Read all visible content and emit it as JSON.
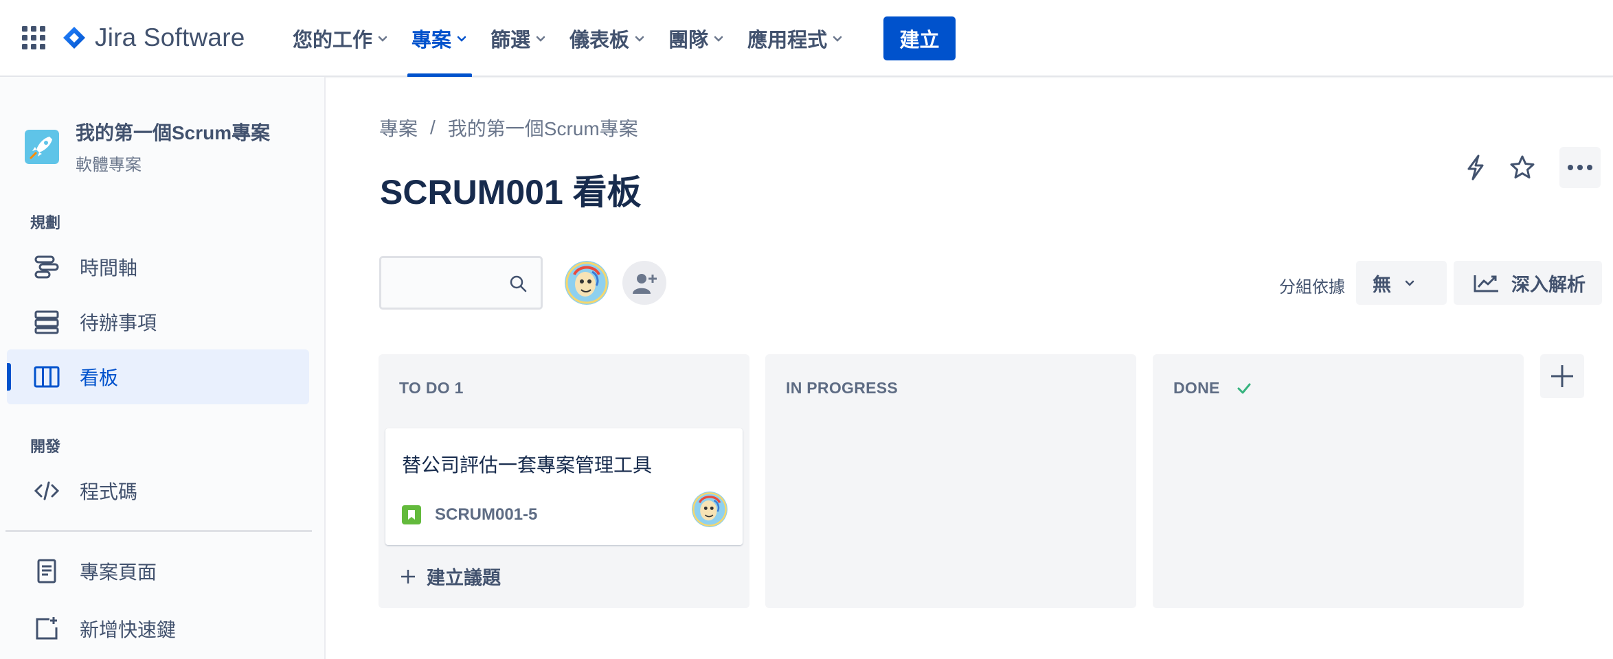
{
  "app": {
    "name": "Jira Software",
    "icons": {
      "apps": "app-switcher-grid-icon",
      "logo": "jira-diamond-logo"
    },
    "accent_color": "#0052cc"
  },
  "topnav": {
    "items": [
      {
        "label": "您的工作",
        "active": false
      },
      {
        "label": "專案",
        "active": true
      },
      {
        "label": "篩選",
        "active": false
      },
      {
        "label": "儀表板",
        "active": false
      },
      {
        "label": "團隊",
        "active": false
      },
      {
        "label": "應用程式",
        "active": false
      }
    ],
    "create_label": "建立"
  },
  "sidebar": {
    "project_name": "我的第一個Scrum專案",
    "project_type": "軟體專案",
    "planning_section": "規劃",
    "planning_items": [
      {
        "label": "時間軸",
        "icon": "timeline-icon"
      },
      {
        "label": "待辦事項",
        "icon": "backlog-icon"
      },
      {
        "label": "看板",
        "icon": "board-icon",
        "active": true
      }
    ],
    "dev_section": "開發",
    "dev_items": [
      {
        "label": "程式碼",
        "icon": "code-icon"
      }
    ],
    "bottom_items": [
      {
        "label": "專案頁面",
        "icon": "page-icon"
      },
      {
        "label": "新增快速鍵",
        "icon": "add-shortcut-icon"
      }
    ]
  },
  "main": {
    "breadcrumb": [
      "專案",
      "我的第一個Scrum專案"
    ],
    "breadcrumb_sep": "/",
    "title": "SCRUM001 看板",
    "header_icons": [
      "automation-lightning-icon",
      "star-icon",
      "more-icon"
    ],
    "search": {
      "value": "",
      "placeholder": ""
    },
    "groupby_label": "分組依據",
    "groupby_value": "無",
    "insights_label": "深入解析"
  },
  "board": {
    "columns": [
      {
        "title": "TO DO 1",
        "done_check": false
      },
      {
        "title": "IN PROGRESS",
        "done_check": false
      },
      {
        "title": "DONE",
        "done_check": true
      }
    ],
    "cards": [
      {
        "column": 0,
        "title": "替公司評估一套專案管理工具",
        "key": "SCRUM001-5",
        "type": "story",
        "type_color": "#63ba3c"
      }
    ],
    "create_issue_label": "建立議題"
  }
}
